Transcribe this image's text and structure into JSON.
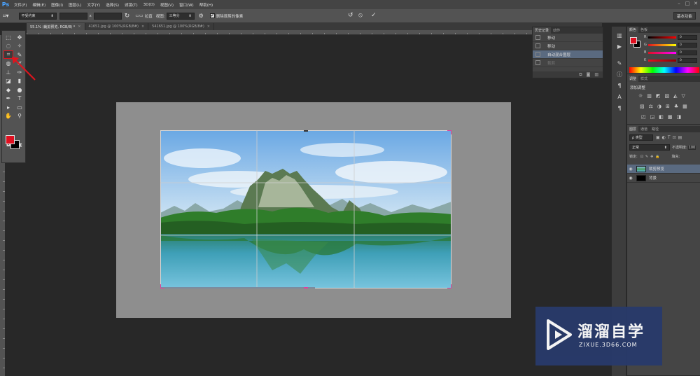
{
  "app": {
    "logo": "Ps"
  },
  "menu": [
    "文件(F)",
    "编辑(E)",
    "图像(I)",
    "图层(L)",
    "文字(Y)",
    "选择(S)",
    "滤镜(T)",
    "3D(D)",
    "视图(V)",
    "窗口(W)",
    "帮助(H)"
  ],
  "window_controls": {
    "minimize": "–",
    "maximize": "□",
    "close": "✕"
  },
  "options": {
    "tool_icon": "crop-icon",
    "ratio_select": "不受约束",
    "width_value": "",
    "x_sign": "x",
    "height_value": "",
    "rotate_icon": "rotate-icon",
    "straighten_label": "拉直",
    "view_label": "视图:",
    "view_select": "三等分",
    "delete_cropped_label": "删除裁剪的像素",
    "delete_cropped_checked": "✔",
    "reset_icon": "↺",
    "cancel_icon": "⦸",
    "commit_icon": "✓",
    "workspace": "基本功能"
  },
  "tabs": [
    {
      "label": "55.1% (裁剪预览, RGB/8) *",
      "active": true,
      "close": "×"
    },
    {
      "label": "41651.jpg @ 100%(RGB/8#)",
      "active": false,
      "close": "×"
    },
    {
      "label": "541651.jpg @ 100%(RGB/8#)",
      "active": false,
      "close": "×"
    }
  ],
  "tools": [
    {
      "name": "marquee-icon",
      "glyph": "⬚"
    },
    {
      "name": "move-icon",
      "glyph": "✥"
    },
    {
      "name": "lasso-icon",
      "glyph": "◌"
    },
    {
      "name": "magic-wand-icon",
      "glyph": "✧"
    },
    {
      "name": "crop-icon",
      "glyph": "⌗"
    },
    {
      "name": "eyedropper-icon",
      "glyph": "✎"
    },
    {
      "name": "healing-icon",
      "glyph": "◍"
    },
    {
      "name": "brush-icon",
      "glyph": "✐"
    },
    {
      "name": "stamp-icon",
      "glyph": "⊥"
    },
    {
      "name": "history-brush-icon",
      "glyph": "✑"
    },
    {
      "name": "eraser-icon",
      "glyph": "◪"
    },
    {
      "name": "gradient-icon",
      "glyph": "▮"
    },
    {
      "name": "blur-icon",
      "glyph": "◆"
    },
    {
      "name": "dodge-icon",
      "glyph": "●"
    },
    {
      "name": "pen-icon",
      "glyph": "✒"
    },
    {
      "name": "type-icon",
      "glyph": "T"
    },
    {
      "name": "path-select-icon",
      "glyph": "▸"
    },
    {
      "name": "shape-icon",
      "glyph": "▭"
    },
    {
      "name": "hand-icon",
      "glyph": "✋"
    },
    {
      "name": "zoom-icon",
      "glyph": "⚲"
    },
    {
      "name": "quick-mask-icon",
      "glyph": "◘"
    },
    {
      "name": "screen-mode-icon",
      "glyph": "▣"
    }
  ],
  "colors": {
    "foreground": "#e01020",
    "background": "#000000"
  },
  "history": {
    "tabs": [
      "历史记录",
      "动作"
    ],
    "rows": [
      {
        "label": "移动",
        "state": "normal"
      },
      {
        "label": "移动",
        "state": "normal"
      },
      {
        "label": "自动混合图层",
        "state": "active"
      },
      {
        "label": "裁剪",
        "state": "dim"
      }
    ]
  },
  "color_panel": {
    "tabs": [
      "颜色",
      "色板"
    ],
    "channels": [
      {
        "label": "R",
        "value": "0"
      },
      {
        "label": "G",
        "value": "0"
      },
      {
        "label": "B",
        "value": "0"
      },
      {
        "label": "K",
        "value": "0"
      }
    ]
  },
  "adjust_panel": {
    "tabs": [
      "调整",
      "样式"
    ],
    "add_label": "添加调整",
    "row1": [
      "☼",
      "▥",
      "◩",
      "▧",
      "◭",
      "▽"
    ],
    "row2": [
      "▨",
      "⚖",
      "◑",
      "⊞",
      "♣",
      "▦"
    ],
    "row3": [
      "◰",
      "◲",
      "◧",
      "▩",
      "◨"
    ]
  },
  "layers_panel": {
    "tabs": [
      "图层",
      "通道",
      "路径"
    ],
    "filter_label": "ρ 类型",
    "blend_mode": "正常",
    "opacity_label": "不透明度:",
    "opacity_value": "100",
    "lock_label": "锁定:",
    "fill_label": "填充:",
    "layers": [
      {
        "name": "裁剪预览",
        "active": true
      },
      {
        "name": "背景",
        "active": false
      }
    ]
  },
  "watermark": {
    "title": "溜溜自学",
    "url": "ZIXUE.3D66.COM"
  }
}
